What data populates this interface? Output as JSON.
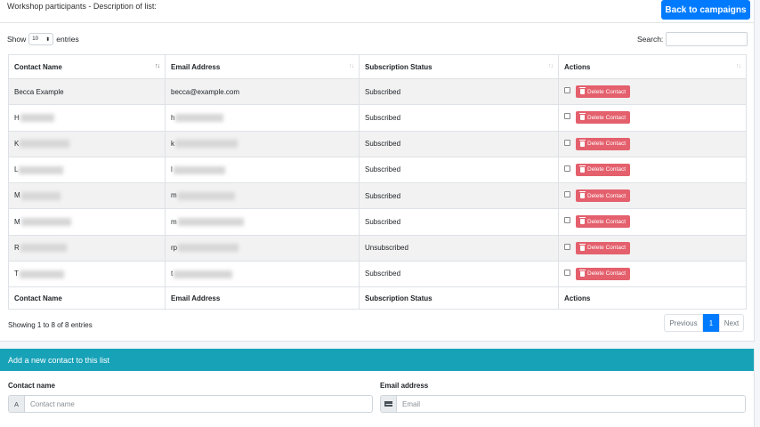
{
  "header": {
    "list_title": "Workshop participants - Description of list:",
    "back_label": "Back to campaigns"
  },
  "controls": {
    "show_label": "Show",
    "show_value": "10",
    "entries_label": "entries",
    "search_label": "Search:"
  },
  "table": {
    "columns": [
      "Contact Name",
      "Email Address",
      "Subscription Status",
      "Actions"
    ],
    "rows": [
      {
        "name": "Becca Example",
        "email": "becca@example.com",
        "status": "Subscribed"
      },
      {
        "name": "H",
        "email": "h",
        "status": "Subscribed"
      },
      {
        "name": "K",
        "email": "k",
        "status": "Subscribed"
      },
      {
        "name": "L",
        "email": "l",
        "status": "Subscribed"
      },
      {
        "name": "M",
        "email": "m",
        "status": "Subscribed"
      },
      {
        "name": "M",
        "email": "m",
        "status": "Subscribed"
      },
      {
        "name": "R",
        "email": "rp",
        "status": "Unsubscribed"
      },
      {
        "name": "T",
        "email": "t",
        "status": "Subscribed"
      }
    ],
    "delete_label": "Delete Contact"
  },
  "footer": {
    "info": "Showing 1 to 8 of 8 entries",
    "prev": "Previous",
    "page": "1",
    "next": "Next"
  },
  "add_form": {
    "header": "Add a new contact to this list",
    "name_label": "Contact name",
    "name_prefix": "A",
    "name_placeholder": "Contact name",
    "email_label": "Email address",
    "email_placeholder": "Email"
  }
}
